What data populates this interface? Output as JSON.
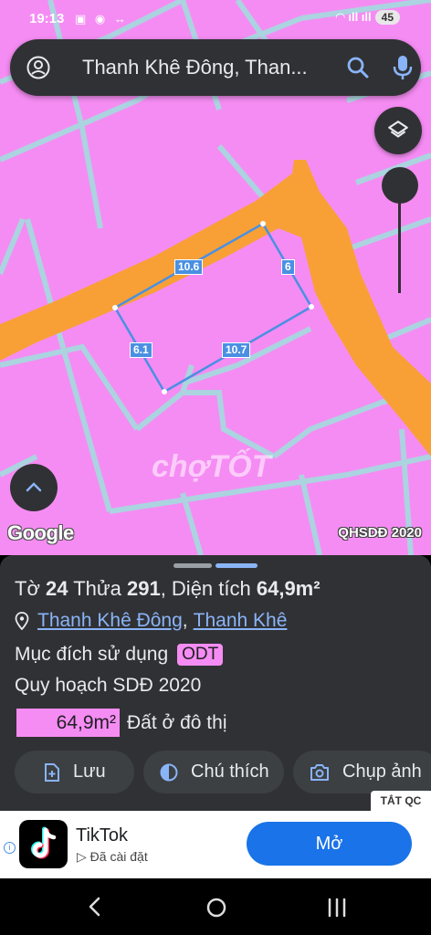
{
  "status_bar": {
    "time": "19:13",
    "notif_icons": "▣ ◉ ↔",
    "signal": "◠ ıll ıll",
    "battery": "45"
  },
  "search": {
    "query": "Thanh Khê Đông, Than..."
  },
  "map": {
    "edges": {
      "top": "10.6",
      "right": "6",
      "left": "6.1",
      "bottom": "10.7"
    },
    "watermark": "chợTỐT",
    "attribution": "Google",
    "layer_label": "QHSDĐ 2020",
    "colors": {
      "land": "#f58cf3",
      "road": "#f8a036",
      "outline": "#4a90e2"
    }
  },
  "sheet": {
    "title_prefix": "Tờ",
    "sheet_no": "24",
    "parcel_label": "Thửa",
    "parcel_no": "291",
    "area_label": ", Diện tích",
    "area_value": "64,9m²",
    "ward": "Thanh Khê Đông",
    "separator": ",",
    "district": "Thanh Khê",
    "purpose_label": "Mục đích sử dụng",
    "purpose_code": "ODT",
    "plan_label": "Quy hoạch SDĐ 2020",
    "zone_area": "64,9m²",
    "zone_desc": "Đất ở đô thị",
    "actions": {
      "save": "Lưu",
      "legend": "Chú thích",
      "capture": "Chụp ảnh"
    }
  },
  "ad": {
    "close_label": "TẮT QC",
    "app_name": "TikTok",
    "app_status": "Đã cài đặt",
    "open_label": "Mở",
    "info": "i"
  }
}
